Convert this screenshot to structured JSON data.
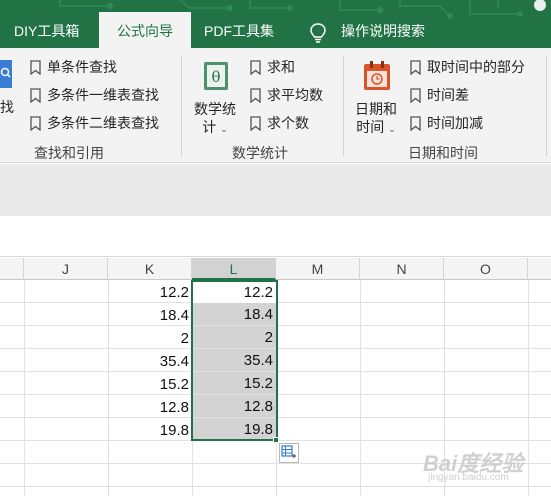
{
  "tabs": [
    {
      "label": "DIY工具箱",
      "active": false
    },
    {
      "label": "公式向导",
      "active": true
    },
    {
      "label": "PDF工具集",
      "active": false
    }
  ],
  "search_hint": "操作说明搜索",
  "ribbon": {
    "lookup": {
      "partial_label": "找",
      "items": [
        "单条件查找",
        "多条件一维表查找",
        "多条件二维表查找"
      ],
      "group_label": "查找和引用"
    },
    "math": {
      "big_button": {
        "line1": "数学统",
        "line2": "计"
      },
      "items": [
        "求和",
        "求平均数",
        "求个数"
      ],
      "group_label": "数学统计"
    },
    "datetime": {
      "big_button": {
        "line1": "日期和",
        "line2": "时间"
      },
      "items": [
        "取时间中的部分",
        "时间差",
        "时间加减"
      ],
      "group_label": "日期和时间"
    }
  },
  "columns": [
    "J",
    "K",
    "L",
    "M",
    "N",
    "O"
  ],
  "selected_column": "L",
  "col_k_values": [
    "12.2",
    "18.4",
    "2",
    "35.4",
    "15.2",
    "12.8",
    "19.8"
  ],
  "col_l_values": [
    "12.2",
    "18.4",
    "2",
    "35.4",
    "15.2",
    "12.8",
    "19.8"
  ],
  "watermark": {
    "main": "Bai度经验",
    "sub": "jingyan.baidu.com"
  },
  "colors": {
    "accent": "#217346",
    "selection_fill": "#d3d3d3"
  }
}
